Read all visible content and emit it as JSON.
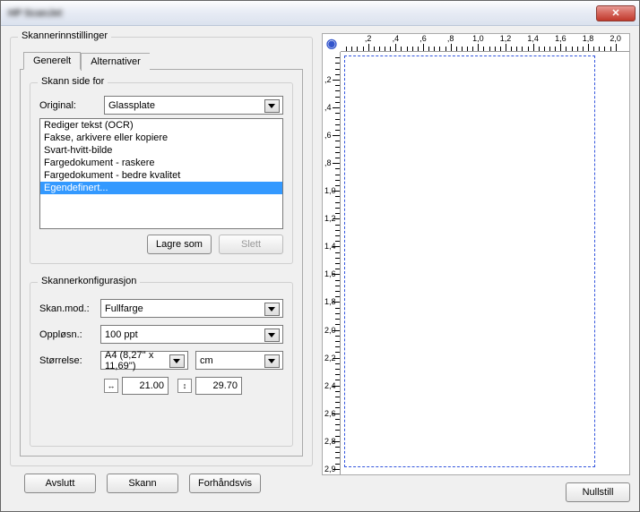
{
  "window": {
    "title": "HP ScanJet"
  },
  "settings": {
    "groupLabel": "Skannerinnstillinger",
    "tabs": {
      "general": "Generelt",
      "alternatives": "Alternativer"
    },
    "scanSide": {
      "groupLabel": "Skann side for",
      "originalLabel": "Original:",
      "originalValue": "Glassplate",
      "listItems": [
        "Rediger tekst (OCR)",
        "Fakse, arkivere eller kopiere",
        "Svart-hvitt-bilde",
        "Fargedokument - raskere",
        "Fargedokument - bedre kvalitet",
        "Egendefinert..."
      ],
      "selectedIndex": 5,
      "saveAsBtn": "Lagre som",
      "deleteBtn": "Slett"
    },
    "config": {
      "groupLabel": "Skannerkonfigurasjon",
      "modeLabel": "Skan.mod.:",
      "modeValue": "Fullfarge",
      "resLabel": "Oppløsn.:",
      "resValue": "100 ppt",
      "sizeLabel": "Størrelse:",
      "sizeValue": "A4 (8,27'' x 11,69'')",
      "unitValue": "cm",
      "width": "21.00",
      "height": "29.70"
    }
  },
  "ruler": {
    "hTicks": [
      ",2",
      ",4",
      ",6",
      ",8",
      "1,0",
      "1,2",
      "1,4",
      "1,6",
      "1,8",
      "2,0"
    ],
    "vTicks": [
      ",2",
      ",4",
      ",6",
      ",8",
      "1,0",
      "1,2",
      "1,4",
      "1,6",
      "1,8",
      "2,0",
      "2,2",
      "2,4",
      "2,6",
      "2,8",
      "2,9"
    ]
  },
  "buttons": {
    "quit": "Avslutt",
    "scan": "Skann",
    "preview": "Forhåndsvis",
    "reset": "Nullstill"
  }
}
